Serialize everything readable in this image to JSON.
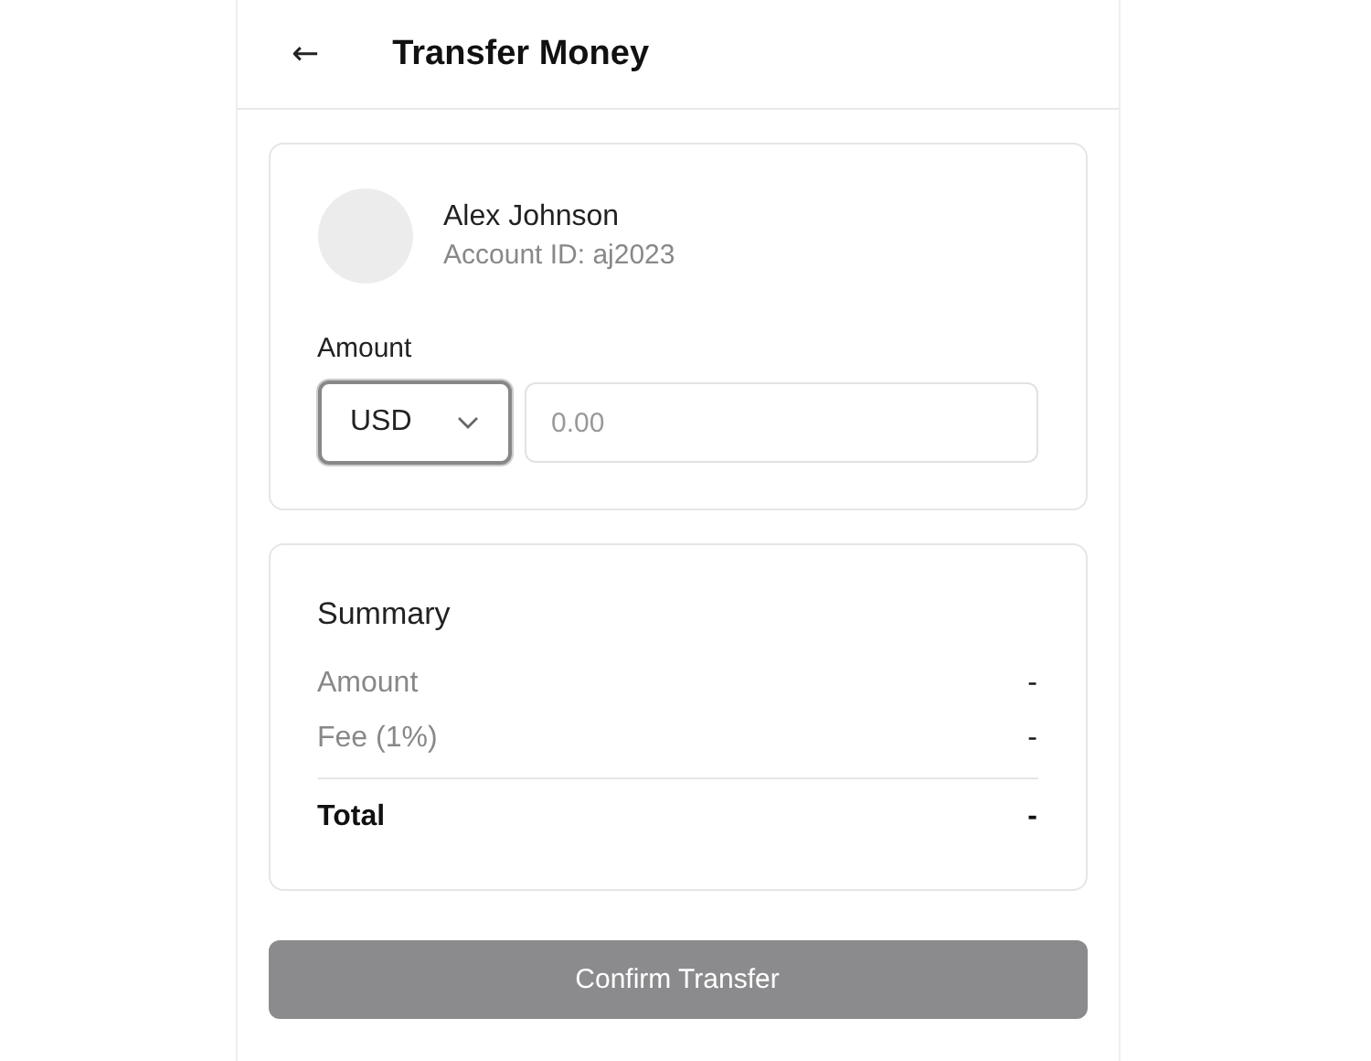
{
  "header": {
    "back": "←",
    "title": "Transfer Money"
  },
  "recipient": {
    "name": "Alex Johnson",
    "account": "Account ID: aj2023"
  },
  "amount": {
    "label": "Amount",
    "currency": "USD",
    "currency_focused": true,
    "placeholder": "0.00"
  },
  "summary": {
    "title": "Summary",
    "rows": [
      {
        "kind": "line",
        "label": "Amount",
        "value": "-"
      },
      {
        "kind": "line",
        "label": "Fee (1%)",
        "value": "-"
      },
      {
        "kind": "total",
        "label": "Total",
        "value": "-"
      }
    ]
  },
  "confirm": {
    "label": "Confirm Transfer",
    "disabled": true
  }
}
